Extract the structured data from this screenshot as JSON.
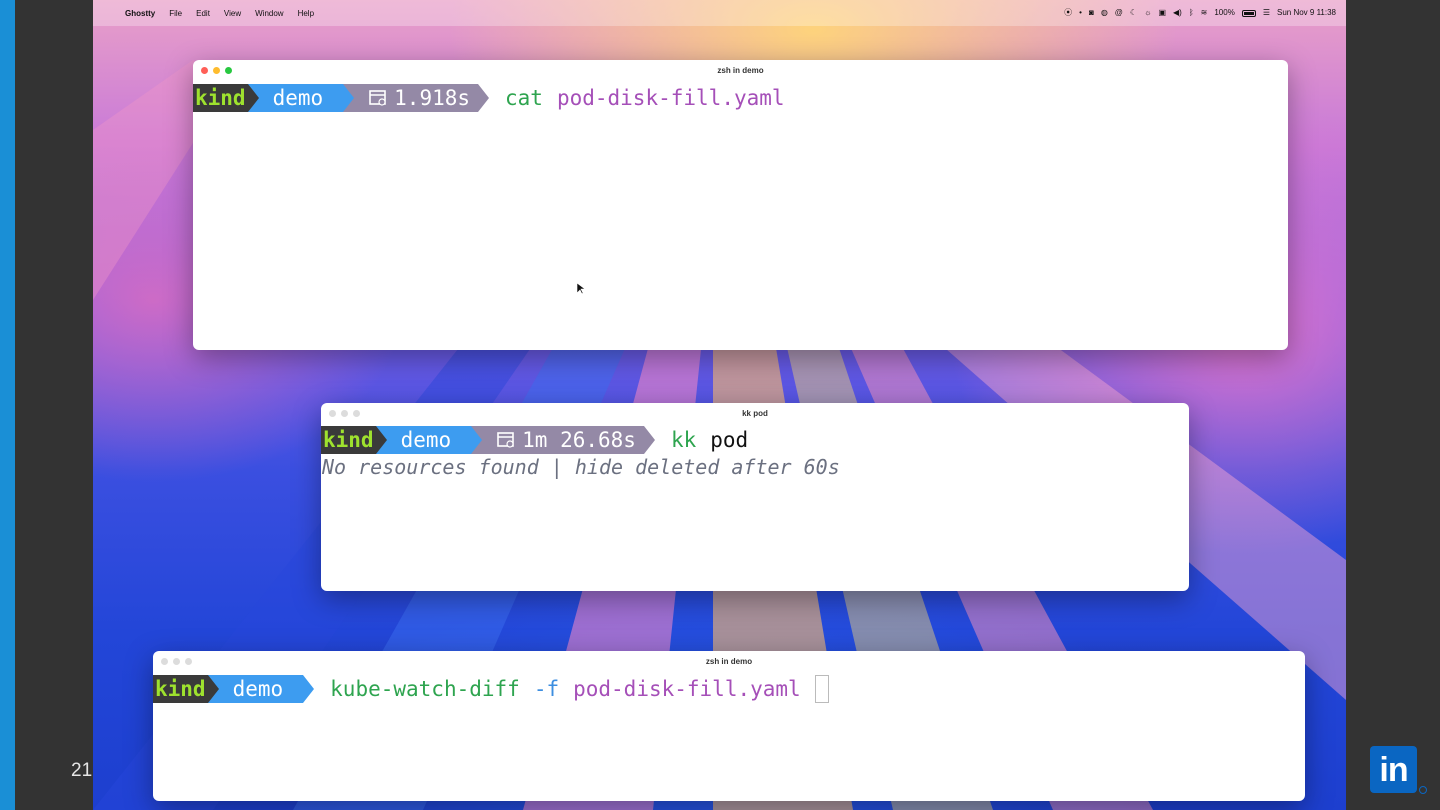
{
  "slide": {
    "number": "21",
    "logo_text": "in"
  },
  "menubar": {
    "app_name": "Ghostty",
    "items": [
      "File",
      "Edit",
      "View",
      "Window",
      "Help"
    ],
    "battery": "100%",
    "datetime": "Sun Nov 9  11:38"
  },
  "windows": [
    {
      "title": "zsh in demo",
      "prompt": {
        "context": "kind",
        "namespace": "demo",
        "duration": "1.918s"
      },
      "command": {
        "name": "cat",
        "args": "pod-disk-fill.yaml"
      }
    },
    {
      "title": "kk pod",
      "prompt": {
        "context": "kind",
        "namespace": "demo",
        "duration": "1m 26.68s"
      },
      "command": {
        "name": "kk",
        "args": "pod"
      },
      "output": "No resources found | hide deleted after 60s"
    },
    {
      "title": "zsh in demo",
      "prompt": {
        "context": "kind",
        "namespace": "demo"
      },
      "command": {
        "name": "kube-watch-diff",
        "flag": "-f",
        "args": "pod-disk-fill.yaml"
      }
    }
  ],
  "colors": {
    "accent_blue": "#3d9cf0",
    "kind_green": "#9ee22e",
    "cmd_green": "#2ea44f",
    "arg_purple": "#a54fb8",
    "linkedin": "#0a66c2"
  }
}
